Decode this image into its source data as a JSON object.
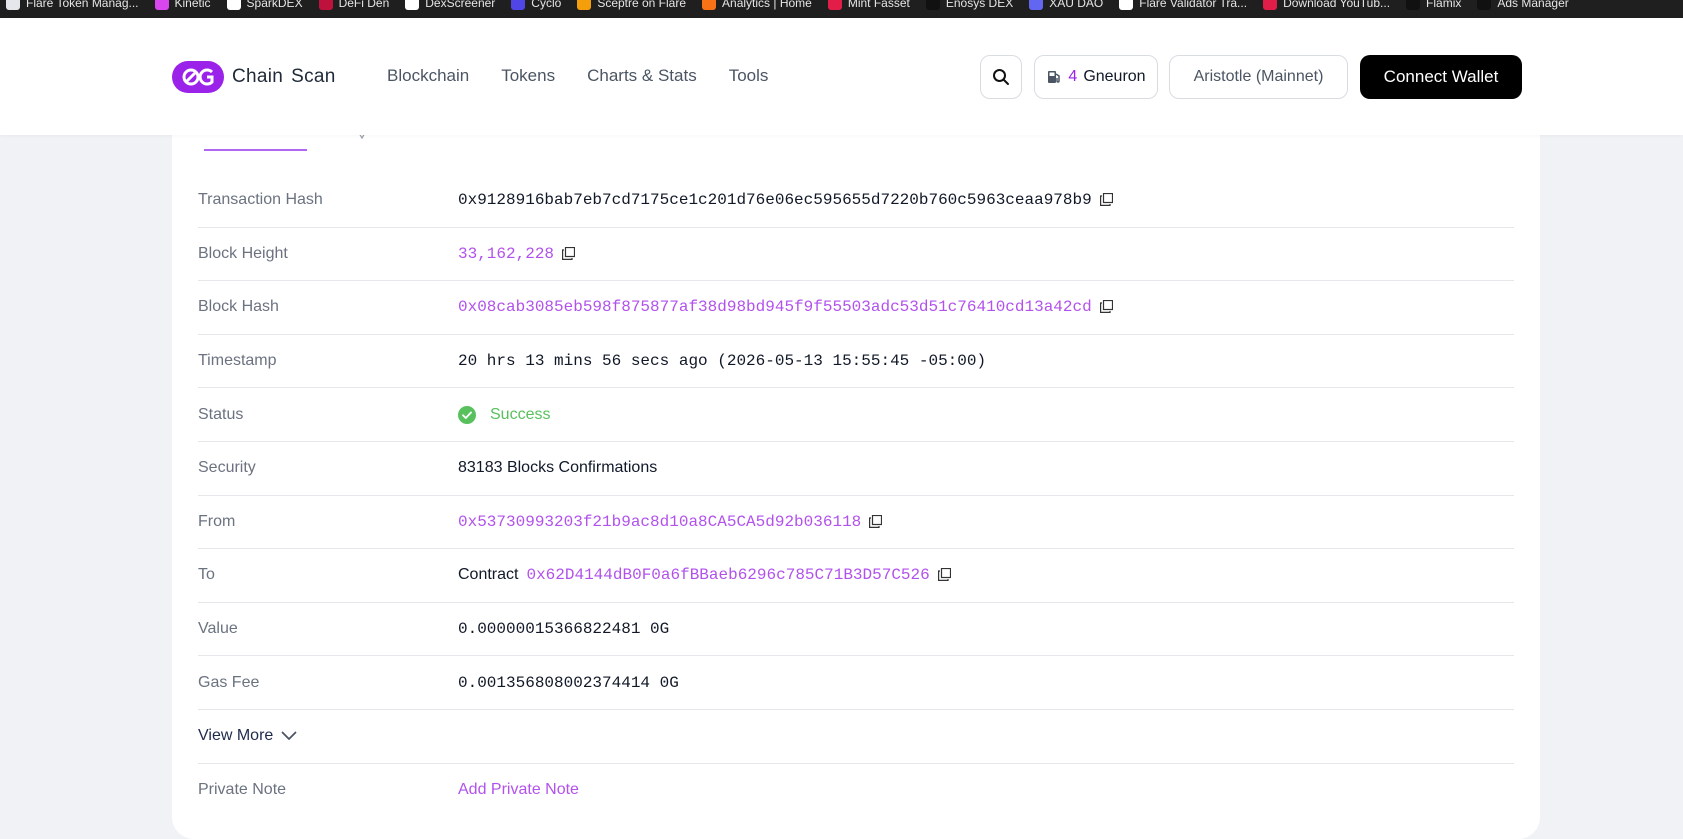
{
  "bookmarks": [
    {
      "label": "Flare Token Manag...",
      "color": "#e5e7eb"
    },
    {
      "label": "Kinetic",
      "color": "#d946ef"
    },
    {
      "label": "SparkDEX",
      "color": "#ffffff"
    },
    {
      "label": "DeFi Den",
      "color": "#be123c"
    },
    {
      "label": "DexScreener",
      "color": "#ffffff"
    },
    {
      "label": "Cyclo",
      "color": "#4f46e5"
    },
    {
      "label": "Sceptre on Flare",
      "color": "#f59e0b"
    },
    {
      "label": "Analytics | Home",
      "color": "#f97316"
    },
    {
      "label": "Mint Fasset",
      "color": "#e11d48"
    },
    {
      "label": "Enosys DEX",
      "color": "#111111"
    },
    {
      "label": "XAU DAO",
      "color": "#6366f1"
    },
    {
      "label": "Flare Validator Tra...",
      "color": "#ffffff"
    },
    {
      "label": "Download YouTub...",
      "color": "#e11d48"
    },
    {
      "label": "Flamix",
      "color": "#111111"
    },
    {
      "label": "Ads Manager",
      "color": "#111111"
    }
  ],
  "header": {
    "logo_text_1": "Chain",
    "logo_text_2": "Scan",
    "nav": [
      "Blockchain",
      "Tokens",
      "Charts & Stats",
      "Tools"
    ],
    "gas_value": "4",
    "gas_unit": "Gneuron",
    "network": "Aristotle (Mainnet)",
    "connect_label": "Connect Wallet"
  },
  "details": {
    "tx_hash_label": "Transaction Hash",
    "tx_hash": "0x9128916bab7eb7cd7175ce1c201d76e06ec595655d7220b760c5963ceaa978b9",
    "block_height_label": "Block Height",
    "block_height": "33,162,228",
    "block_hash_label": "Block Hash",
    "block_hash": "0x08cab3085eb598f875877af38d98bd945f9f55503adc53d51c76410cd13a42cd",
    "timestamp_label": "Timestamp",
    "timestamp": "20 hrs 13 mins 56 secs ago (2026-05-13 15:55:45 -05:00)",
    "status_label": "Status",
    "status": "Success",
    "security_label": "Security",
    "security": "83183 Blocks Confirmations",
    "from_label": "From",
    "from": "0x53730993203f21b9ac8d10a8CA5CA5d92b036118",
    "to_label": "To",
    "to_prefix": "Contract",
    "to": "0x62D4144dB0F0a6fBBaeb6296c785C71B3D57C526",
    "value_label": "Value",
    "value": "0.00000015366822481 0G",
    "gas_fee_label": "Gas Fee",
    "gas_fee": "0.001356808002374414 0G",
    "view_more_label": "View More",
    "private_note_label": "Private Note",
    "private_note_action": "Add Private Note"
  },
  "colors": {
    "accent": "#9b22e8",
    "link": "#b252ec",
    "success": "#58c15e"
  }
}
